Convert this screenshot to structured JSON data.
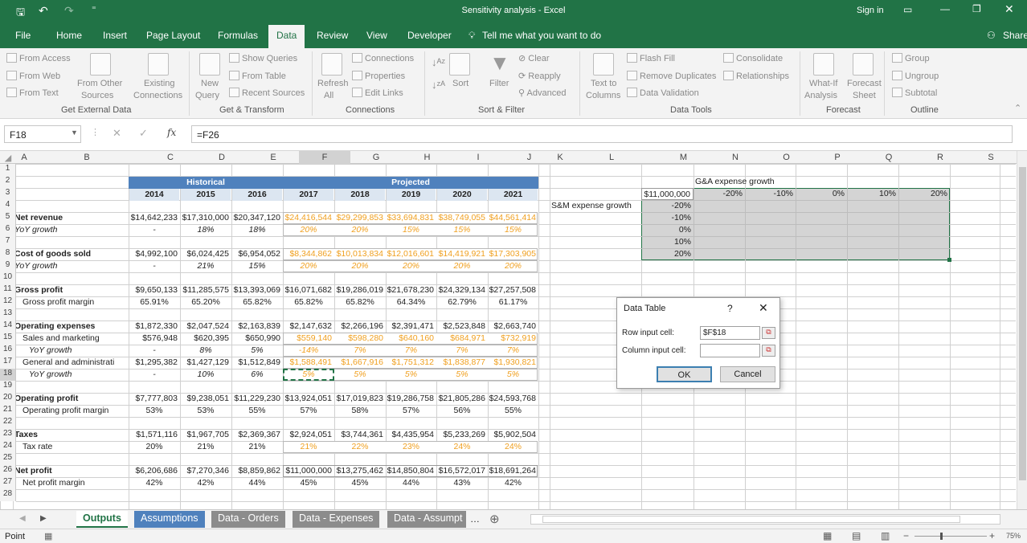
{
  "window": {
    "title": "Sensitivity analysis - Excel",
    "signin": "Sign in",
    "share": "Share"
  },
  "tabs": [
    "File",
    "Home",
    "Insert",
    "Page Layout",
    "Formulas",
    "Data",
    "Review",
    "View",
    "Developer"
  ],
  "tell_me": "Tell me what you want to do",
  "ribbon": {
    "get_external": {
      "from_access": "From Access",
      "from_web": "From Web",
      "from_text": "From Text",
      "from_other": "From Other",
      "sources": "Sources",
      "existing": "Existing",
      "connections": "Connections",
      "group": "Get External Data"
    },
    "transform": {
      "new": "New",
      "query": "Query",
      "show_queries": "Show Queries",
      "from_table": "From Table",
      "recent_sources": "Recent Sources",
      "group": "Get & Transform"
    },
    "connections": {
      "refresh": "Refresh",
      "all": "All",
      "connections": "Connections",
      "properties": "Properties",
      "edit_links": "Edit Links",
      "group": "Connections"
    },
    "sortfilter": {
      "sort": "Sort",
      "filter": "Filter",
      "clear": "Clear",
      "reapply": "Reapply",
      "advanced": "Advanced",
      "group": "Sort & Filter"
    },
    "datatools": {
      "text_to": "Text to",
      "columns": "Columns",
      "flash_fill": "Flash Fill",
      "remove_dup": "Remove Duplicates",
      "data_validation": "Data Validation",
      "consolidate": "Consolidate",
      "relationships": "Relationships",
      "group": "Data Tools"
    },
    "forecast": {
      "whatif": "What-If",
      "analysis": "Analysis",
      "forecast": "Forecast",
      "sheet": "Sheet",
      "group": "Forecast"
    },
    "outline": {
      "group_btn": "Group",
      "ungroup": "Ungroup",
      "subtotal": "Subtotal",
      "group": "Outline"
    }
  },
  "namebox": "F18",
  "formula": "=F26",
  "fx": "fx",
  "columns": [
    "A",
    "B",
    "C",
    "D",
    "E",
    "F",
    "G",
    "H",
    "I",
    "J",
    "K",
    "L",
    "M",
    "N",
    "O",
    "P",
    "Q",
    "R",
    "S"
  ],
  "rows": [
    "1",
    "2",
    "3",
    "4",
    "5",
    "6",
    "7",
    "8",
    "9",
    "10",
    "11",
    "12",
    "13",
    "14",
    "15",
    "16",
    "17",
    "18",
    "19",
    "20",
    "21",
    "22",
    "23",
    "24",
    "25",
    "26",
    "27",
    "28"
  ],
  "sheet": {
    "historical": "Historical",
    "projected": "Projected",
    "years": [
      "2014",
      "2015",
      "2016",
      "2017",
      "2018",
      "2019",
      "2020",
      "2021"
    ],
    "lines": [
      {
        "row": 5,
        "label": "Net revenue",
        "bold": true,
        "vals": [
          "$14,642,233",
          "$17,310,000",
          "$20,347,120",
          "$24,416,544",
          "$29,299,853",
          "$33,694,831",
          "$38,749,055",
          "$44,561,414"
        ],
        "orange": true
      },
      {
        "row": 6,
        "label": "YoY growth",
        "italic": true,
        "vals": [
          "-",
          "18%",
          "18%",
          "20%",
          "20%",
          "15%",
          "15%",
          "15%"
        ],
        "orange": true
      },
      {
        "row": 8,
        "label": "Cost of goods sold",
        "bold": true,
        "vals": [
          "$4,992,100",
          "$6,024,425",
          "$6,954,052",
          "$8,344,862",
          "$10,013,834",
          "$12,016,601",
          "$14,419,921",
          "$17,303,905"
        ],
        "orange": true
      },
      {
        "row": 9,
        "label": "YoY growth",
        "italic": true,
        "vals": [
          "-",
          "21%",
          "15%",
          "20%",
          "20%",
          "20%",
          "20%",
          "20%"
        ],
        "orange": true
      },
      {
        "row": 11,
        "label": "Gross profit",
        "bold": true,
        "vals": [
          "$9,650,133",
          "$11,285,575",
          "$13,393,069",
          "$16,071,682",
          "$19,286,019",
          "$21,678,230",
          "$24,329,134",
          "$27,257,508"
        ]
      },
      {
        "row": 12,
        "label": "Gross profit margin",
        "indent": true,
        "vals": [
          "65.91%",
          "65.20%",
          "65.82%",
          "65.82%",
          "65.82%",
          "64.34%",
          "62.79%",
          "61.17%"
        ]
      },
      {
        "row": 14,
        "label": "Operating expenses",
        "bold": true,
        "vals": [
          "$1,872,330",
          "$2,047,524",
          "$2,163,839",
          "$2,147,632",
          "$2,266,196",
          "$2,391,471",
          "$2,523,848",
          "$2,663,740"
        ]
      },
      {
        "row": 15,
        "label": "Sales and marketing",
        "indent": true,
        "vals": [
          "$576,948",
          "$620,395",
          "$650,990",
          "$559,140",
          "$598,280",
          "$640,160",
          "$684,971",
          "$732,919"
        ],
        "orange": true
      },
      {
        "row": 16,
        "label": "YoY growth",
        "italic": true,
        "indent2": true,
        "vals": [
          "-",
          "8%",
          "5%",
          "-14%",
          "7%",
          "7%",
          "7%",
          "7%"
        ],
        "orange": true
      },
      {
        "row": 17,
        "label": "General and administrati",
        "indent": true,
        "vals": [
          "$1,295,382",
          "$1,427,129",
          "$1,512,849",
          "$1,588,491",
          "$1,667,916",
          "$1,751,312",
          "$1,838,877",
          "$1,930,821"
        ],
        "orange": true
      },
      {
        "row": 18,
        "label": "YoY growth",
        "italic": true,
        "indent2": true,
        "vals": [
          "-",
          "10%",
          "6%",
          "5%",
          "5%",
          "5%",
          "5%",
          "5%"
        ],
        "orange": true
      },
      {
        "row": 20,
        "label": "Operating profit",
        "bold": true,
        "vals": [
          "$7,777,803",
          "$9,238,051",
          "$11,229,230",
          "$13,924,051",
          "$17,019,823",
          "$19,286,758",
          "$21,805,286",
          "$24,593,768"
        ]
      },
      {
        "row": 21,
        "label": "Operating profit margin",
        "indent": true,
        "vals": [
          "53%",
          "53%",
          "55%",
          "57%",
          "58%",
          "57%",
          "56%",
          "55%"
        ]
      },
      {
        "row": 23,
        "label": "Taxes",
        "bold": true,
        "vals": [
          "$1,571,116",
          "$1,967,705",
          "$2,369,367",
          "$2,924,051",
          "$3,744,361",
          "$4,435,954",
          "$5,233,269",
          "$5,902,504"
        ]
      },
      {
        "row": 24,
        "label": "Tax rate",
        "indent": true,
        "vals": [
          "20%",
          "21%",
          "21%",
          "21%",
          "22%",
          "23%",
          "24%",
          "24%"
        ],
        "orange": true
      },
      {
        "row": 26,
        "label": "Net profit",
        "bold": true,
        "vals": [
          "$6,206,686",
          "$7,270,346",
          "$8,859,862",
          "$11,000,000",
          "$13,275,462",
          "$14,850,804",
          "$16,572,017",
          "$18,691,264"
        ]
      },
      {
        "row": 27,
        "label": "Net profit margin",
        "indent": true,
        "vals": [
          "42%",
          "42%",
          "44%",
          "45%",
          "45%",
          "44%",
          "43%",
          "42%"
        ]
      }
    ],
    "sens": {
      "top_label": "G&A expense growth",
      "side_label": "S&M expense growth",
      "corner": "$11,000,000",
      "cols": [
        "-20%",
        "-10%",
        "0%",
        "10%",
        "20%"
      ],
      "rows": [
        "-20%",
        "-10%",
        "0%",
        "10%",
        "20%"
      ]
    }
  },
  "dialog": {
    "title": "Data Table",
    "help": "?",
    "row_label": "Row input cell:",
    "row_value": "$F$18",
    "col_label": "Column input cell:",
    "col_value": "",
    "ok": "OK",
    "cancel": "Cancel"
  },
  "sheet_tabs": [
    "Outputs",
    "Assumptions",
    "Data - Orders",
    "Data - Expenses",
    "Data - Assumpt"
  ],
  "status": {
    "mode": "Point",
    "zoom": "75%"
  }
}
